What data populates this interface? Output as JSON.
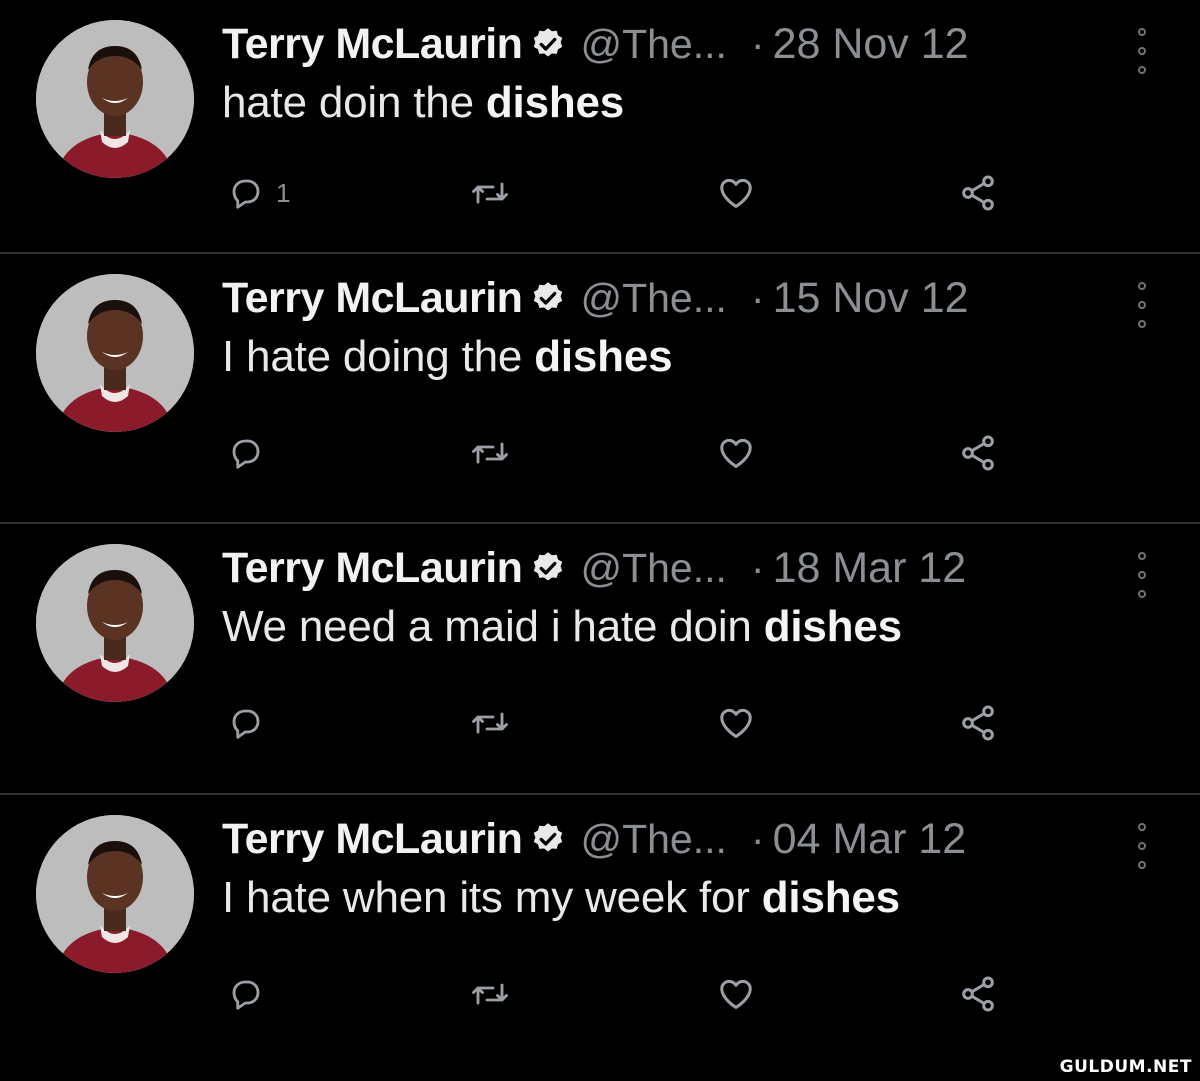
{
  "tweets": [
    {
      "name": "Terry McLaurin",
      "handle": "@The...",
      "dot": "·",
      "date": "28 Nov 12",
      "text_plain": "hate doin the ",
      "text_bold": "dishes",
      "reply_count": "1"
    },
    {
      "name": "Terry McLaurin",
      "handle": "@The...",
      "dot": "·",
      "date": "15 Nov 12",
      "text_plain": "I hate doing the ",
      "text_bold": "dishes",
      "reply_count": ""
    },
    {
      "name": "Terry McLaurin",
      "handle": "@The...",
      "dot": "·",
      "date": "18 Mar 12",
      "text_plain": "We need a maid i hate doin ",
      "text_bold": "dishes",
      "reply_count": ""
    },
    {
      "name": "Terry McLaurin",
      "handle": "@The...",
      "dot": "·",
      "date": "04 Mar 12",
      "text_plain": "I hate when its my week for ",
      "text_bold": "dishes",
      "reply_count": ""
    }
  ],
  "watermark": "GULDUM.NET",
  "icons": {
    "verified": "verified-badge-icon",
    "more": "more-vertical-icon",
    "reply": "reply-icon",
    "retweet": "retweet-icon",
    "like": "heart-icon",
    "share": "share-icon"
  },
  "colors": {
    "background": "#000000",
    "text": "#e7e9ea",
    "secondary": "#8b8f94",
    "divider": "#2f3336",
    "jersey": "#8b1a2a"
  }
}
